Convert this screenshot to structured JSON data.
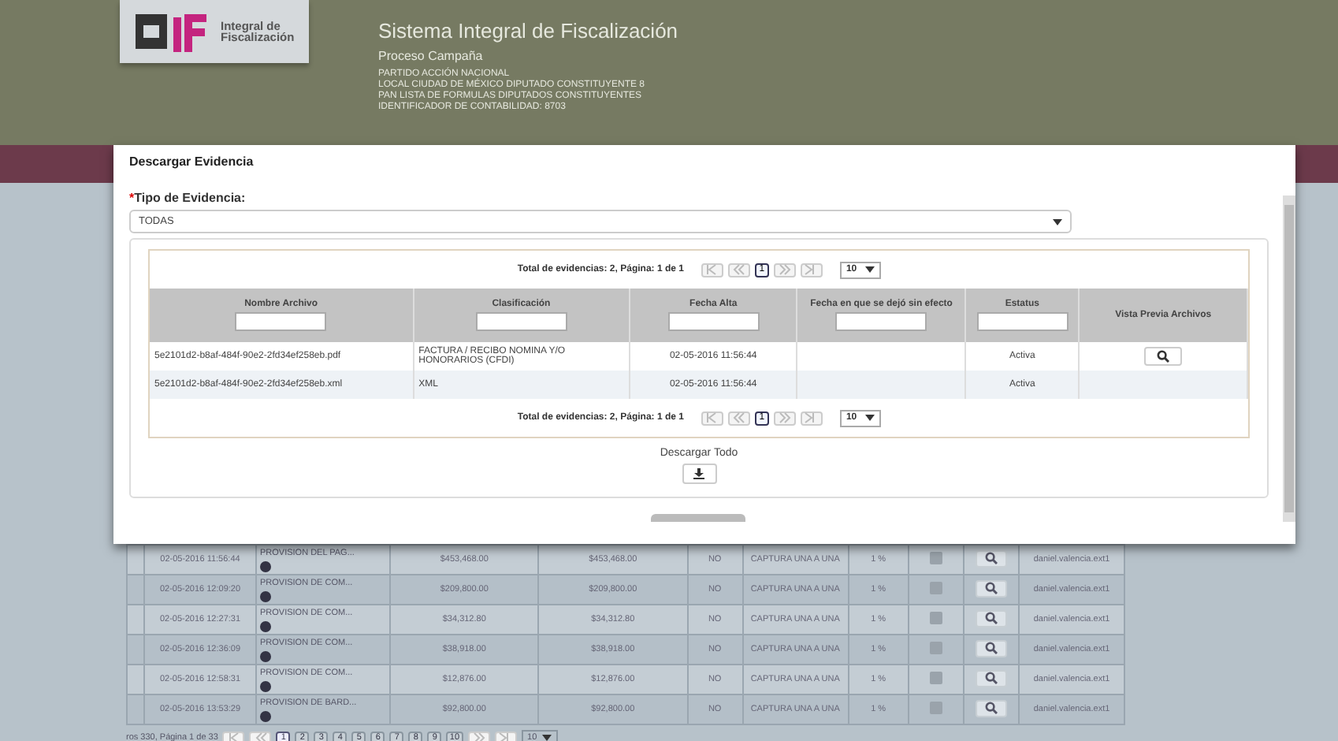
{
  "header": {
    "logo_text": "Integral de Fiscalización",
    "title": "Sistema Integral de Fiscalización",
    "subtitle": "Proceso Campaña",
    "lines": [
      "PARTIDO ACCIÓN NACIONAL",
      "LOCAL CIUDAD DE MÉXICO DIPUTADO CONSTITUYENTE 8",
      "PAN LISTA DE FORMULAS DIPUTADOS CONSTITUYENTES",
      "IDENTIFICADOR DE CONTABILIDAD: 8703"
    ]
  },
  "background_table": {
    "rows": [
      {
        "date": "02-05-2016 11:56:44",
        "concept": "PROVISION DEL PAG...",
        "amount": "$453,468.00",
        "amount_2": "$453,468.00",
        "flag": "NO",
        "capture": "CAPTURA UNA A UNA",
        "percent": "1 %",
        "checked": false,
        "user": "daniel.valencia.ext1"
      },
      {
        "date": "02-05-2016 12:09:20",
        "concept": "PROVISION DE COM...",
        "amount": "$209,800.00",
        "amount_2": "$209,800.00",
        "flag": "NO",
        "capture": "CAPTURA UNA A UNA",
        "percent": "1 %",
        "checked": false,
        "user": "daniel.valencia.ext1"
      },
      {
        "date": "02-05-2016 12:27:31",
        "concept": "PROVISION DE COM...",
        "amount": "$34,312.80",
        "amount_2": "$34,312.80",
        "flag": "NO",
        "capture": "CAPTURA UNA A UNA",
        "percent": "1 %",
        "checked": false,
        "user": "daniel.valencia.ext1"
      },
      {
        "date": "02-05-2016 12:36:09",
        "concept": "PROVISION DE COM...",
        "amount": "$38,918.00",
        "amount_2": "$38,918.00",
        "flag": "NO",
        "capture": "CAPTURA UNA A UNA",
        "percent": "1 %",
        "checked": false,
        "user": "daniel.valencia.ext1"
      },
      {
        "date": "02-05-2016 12:58:31",
        "concept": "PROVISION DE COM...",
        "amount": "$12,876.00",
        "amount_2": "$12,876.00",
        "flag": "NO",
        "capture": "CAPTURA UNA A UNA",
        "percent": "1 %",
        "checked": false,
        "user": "daniel.valencia.ext1"
      },
      {
        "date": "02-05-2016 13:53:29",
        "concept": "PROVISION DE BARD...",
        "amount": "$92,800.00",
        "amount_2": "$92,800.00",
        "flag": "NO",
        "capture": "CAPTURA UNA A UNA",
        "percent": "1 %",
        "checked": false,
        "user": "daniel.valencia.ext1"
      }
    ],
    "pager_text": "ros 330, Página 1 de 33",
    "pages": [
      {
        "label": "1",
        "selected": true
      },
      {
        "label": "2",
        "selected": false
      },
      {
        "label": "3",
        "selected": false
      },
      {
        "label": "4",
        "selected": false
      },
      {
        "label": "5",
        "selected": false
      },
      {
        "label": "6",
        "selected": false
      },
      {
        "label": "7",
        "selected": false
      },
      {
        "label": "8",
        "selected": false
      },
      {
        "label": "9",
        "selected": false
      },
      {
        "label": "10",
        "selected": false
      }
    ],
    "page_size": "10"
  },
  "dialog": {
    "title": "Descargar Evidencia",
    "field": {
      "required_mark": "*",
      "label": "Tipo de Evidencia:",
      "value": "TODAS"
    },
    "pager_top": {
      "text": "Total de evidencias: 2, Página: 1 de 1",
      "pages": [
        {
          "label": "1",
          "selected": true
        }
      ],
      "page_size": "10"
    },
    "columns": [
      {
        "label": "Nombre Archivo",
        "filter": true
      },
      {
        "label": "Clasificación",
        "filter": true
      },
      {
        "label": "Fecha Alta",
        "filter": true
      },
      {
        "label": "Fecha en que se dejó sin efecto",
        "filter": true
      },
      {
        "label": "Estatus",
        "filter": true
      },
      {
        "label": "Vista Previa Archivos",
        "filter": false
      }
    ],
    "rows": [
      {
        "name": "5e2101d2-b8af-484f-90e2-2fd34ef258eb.pdf",
        "classification": "FACTURA / RECIBO NOMINA Y/O HONORARIOS (CFDI)",
        "date": "02-05-2016 11:56:44",
        "status": "Activa",
        "preview": true
      },
      {
        "name": "5e2101d2-b8af-484f-90e2-2fd34ef258eb.xml",
        "classification": "XML",
        "date": "02-05-2016 11:56:44",
        "status": "Activa",
        "preview": false
      }
    ],
    "pager_bottom": {
      "text": "Total de evidencias: 2, Página: 1 de 1",
      "pages": [
        {
          "label": "1",
          "selected": true
        }
      ],
      "page_size": "10"
    },
    "download_label": "Descargar Todo"
  }
}
